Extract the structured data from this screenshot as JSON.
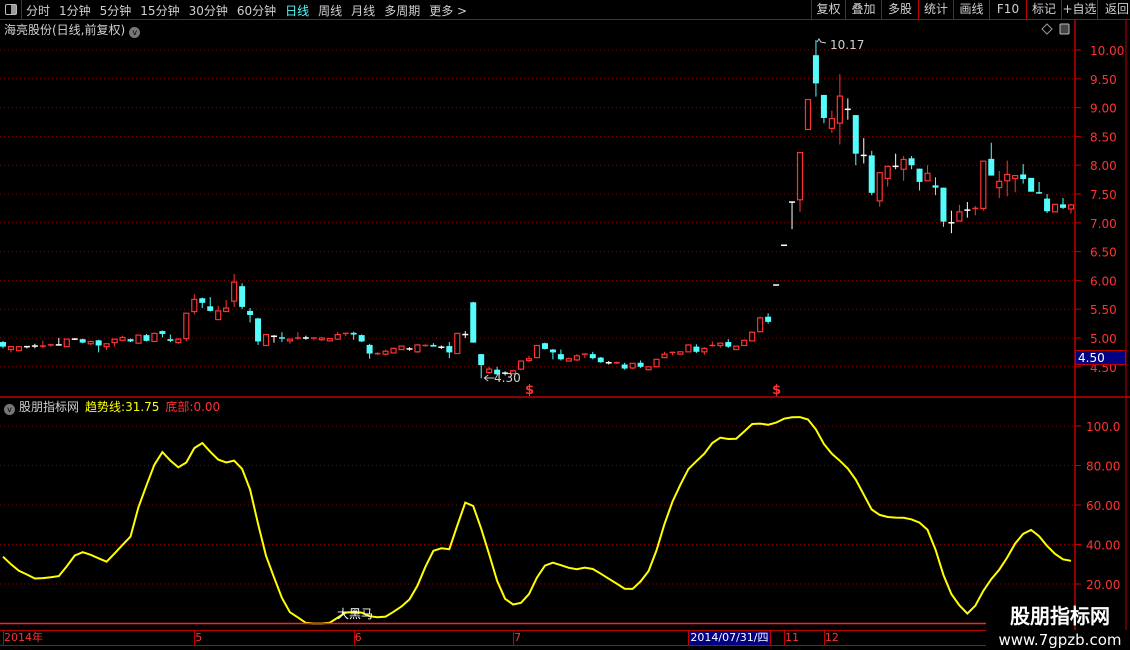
{
  "toolbar": {
    "tabs": [
      "分时",
      "1分钟",
      "5分钟",
      "15分钟",
      "30分钟",
      "60分钟",
      "日线",
      "周线",
      "月线",
      "多周期",
      "更多 >"
    ],
    "active_tab": "日线",
    "right_buttons": [
      "复权",
      "叠加",
      "多股",
      "统计",
      "画线",
      "F10",
      "标记",
      "+自选",
      "返回"
    ]
  },
  "price_panel": {
    "title": "海亮股份(日线,前复权)",
    "high_label": "10.17",
    "low_label": "4.30",
    "cursor_price": "4.50",
    "signal_marker": "$",
    "axis_ticks": [
      "10.00",
      "9.50",
      "9.00",
      "8.50",
      "8.00",
      "7.50",
      "7.00",
      "6.50",
      "6.00",
      "5.50",
      "5.00",
      "4.50"
    ]
  },
  "indicator_panel": {
    "name": "股朋指标网",
    "trend_label": "趋势线:",
    "trend_value": "31.75",
    "bottom_label": "底部:",
    "bottom_value": "0.00",
    "annotation": "大黑马",
    "axis_ticks": [
      "100.0",
      "80.00",
      "60.00",
      "40.00",
      "20.00"
    ]
  },
  "date_axis": {
    "labels": [
      {
        "text": "2014年",
        "index": 0
      },
      {
        "text": "5",
        "index": 24
      },
      {
        "text": "6",
        "index": 44
      },
      {
        "text": "7",
        "index": 64
      },
      {
        "text": "11",
        "index": 98
      },
      {
        "text": "12",
        "index": 103
      }
    ],
    "cursor_date": "2014/07/31/四",
    "cursor_index": 86
  },
  "watermark": {
    "line1": "股朋指标网",
    "line2": "www.7gpzb.com"
  },
  "colors": {
    "up": "#ff3232",
    "down": "#54fcfc",
    "flat": "#ffffff",
    "trend": "#ffff00",
    "axis": "#c00000",
    "accent": "#54fcfc"
  },
  "chart_data": [
    {
      "type": "candlestick",
      "title": "海亮股份(日线,前复权)",
      "ylim": [
        4.3,
        10.3
      ],
      "grid": true,
      "ohlc_columns": [
        "open",
        "high",
        "low",
        "close"
      ],
      "signals_at_index": [
        66,
        97
      ],
      "candles": [
        [
          4.93,
          4.95,
          4.82,
          4.85
        ],
        [
          4.8,
          4.86,
          4.75,
          4.85
        ],
        [
          4.78,
          4.86,
          4.77,
          4.85
        ],
        [
          4.85,
          4.86,
          4.82,
          4.85
        ],
        [
          4.86,
          4.9,
          4.82,
          4.86
        ],
        [
          4.84,
          4.95,
          4.82,
          4.86
        ],
        [
          4.86,
          4.9,
          4.85,
          4.88
        ],
        [
          4.88,
          5.0,
          4.87,
          4.88
        ],
        [
          4.85,
          4.99,
          4.84,
          4.98
        ],
        [
          4.98,
          5.0,
          4.97,
          4.98
        ],
        [
          4.98,
          4.99,
          4.91,
          4.92
        ],
        [
          4.9,
          4.95,
          4.88,
          4.94
        ],
        [
          4.96,
          4.97,
          4.75,
          4.87
        ],
        [
          4.85,
          4.91,
          4.79,
          4.9
        ],
        [
          4.92,
          4.99,
          4.85,
          4.98
        ],
        [
          4.96,
          5.04,
          4.95,
          5.01
        ],
        [
          4.98,
          4.99,
          4.93,
          4.94
        ],
        [
          4.91,
          5.06,
          4.9,
          5.05
        ],
        [
          5.05,
          5.07,
          4.94,
          4.95
        ],
        [
          4.94,
          5.09,
          4.93,
          5.08
        ],
        [
          5.12,
          5.13,
          5.01,
          5.07
        ],
        [
          4.98,
          5.06,
          4.93,
          4.95
        ],
        [
          4.92,
          5.0,
          4.9,
          4.98
        ],
        [
          4.99,
          5.44,
          4.94,
          5.43
        ],
        [
          5.46,
          5.76,
          5.41,
          5.67
        ],
        [
          5.69,
          5.7,
          5.52,
          5.61
        ],
        [
          5.55,
          5.71,
          5.46,
          5.47
        ],
        [
          5.32,
          5.56,
          5.31,
          5.47
        ],
        [
          5.46,
          5.66,
          5.45,
          5.52
        ],
        [
          5.64,
          6.11,
          5.54,
          5.97
        ],
        [
          5.9,
          5.95,
          5.5,
          5.54
        ],
        [
          5.47,
          5.52,
          5.27,
          5.4
        ],
        [
          5.34,
          5.35,
          4.88,
          4.94
        ],
        [
          4.87,
          5.07,
          4.86,
          5.06
        ],
        [
          5.03,
          5.05,
          4.92,
          5.03
        ],
        [
          5.0,
          5.1,
          4.93,
          4.98
        ],
        [
          4.95,
          4.99,
          4.9,
          4.98
        ],
        [
          4.98,
          5.1,
          4.97,
          5.0
        ],
        [
          5.0,
          5.04,
          4.97,
          5.0
        ],
        [
          4.98,
          5.01,
          4.96,
          5.0
        ],
        [
          4.97,
          5.02,
          4.95,
          5.0
        ],
        [
          4.95,
          5.0,
          4.94,
          4.99
        ],
        [
          4.98,
          5.11,
          4.97,
          5.06
        ],
        [
          5.06,
          5.08,
          5.03,
          5.08
        ],
        [
          5.09,
          5.11,
          4.97,
          5.06
        ],
        [
          5.05,
          5.06,
          4.93,
          4.94
        ],
        [
          4.88,
          4.9,
          4.64,
          4.73
        ],
        [
          4.71,
          4.75,
          4.7,
          4.73
        ],
        [
          4.72,
          4.8,
          4.7,
          4.77
        ],
        [
          4.74,
          4.83,
          4.73,
          4.82
        ],
        [
          4.8,
          4.86,
          4.79,
          4.86
        ],
        [
          4.81,
          4.84,
          4.78,
          4.81
        ],
        [
          4.76,
          4.9,
          4.74,
          4.88
        ],
        [
          4.86,
          4.89,
          4.85,
          4.87
        ],
        [
          4.88,
          4.91,
          4.85,
          4.85
        ],
        [
          4.84,
          4.87,
          4.81,
          4.84
        ],
        [
          4.86,
          4.93,
          4.65,
          4.75
        ],
        [
          4.73,
          5.09,
          4.72,
          5.08
        ],
        [
          5.06,
          5.12,
          5.0,
          5.06
        ],
        [
          5.62,
          5.63,
          4.92,
          4.92
        ],
        [
          4.72,
          4.72,
          4.3,
          4.53
        ],
        [
          4.4,
          4.5,
          4.38,
          4.46
        ],
        [
          4.45,
          4.5,
          4.36,
          4.37
        ],
        [
          4.39,
          4.42,
          4.35,
          4.39
        ],
        [
          4.38,
          4.45,
          4.37,
          4.43
        ],
        [
          4.46,
          4.61,
          4.44,
          4.6
        ],
        [
          4.61,
          4.69,
          4.58,
          4.64
        ],
        [
          4.66,
          4.88,
          4.65,
          4.87
        ],
        [
          4.91,
          4.92,
          4.8,
          4.81
        ],
        [
          4.8,
          4.81,
          4.63,
          4.75
        ],
        [
          4.72,
          4.8,
          4.61,
          4.63
        ],
        [
          4.6,
          4.66,
          4.59,
          4.64
        ],
        [
          4.62,
          4.72,
          4.6,
          4.69
        ],
        [
          4.71,
          4.72,
          4.65,
          4.72
        ],
        [
          4.72,
          4.76,
          4.63,
          4.65
        ],
        [
          4.66,
          4.67,
          4.57,
          4.58
        ],
        [
          4.57,
          4.6,
          4.54,
          4.57
        ],
        [
          4.56,
          4.59,
          4.55,
          4.57
        ],
        [
          4.54,
          4.57,
          4.45,
          4.47
        ],
        [
          4.48,
          4.57,
          4.46,
          4.56
        ],
        [
          4.57,
          4.61,
          4.48,
          4.5
        ],
        [
          4.45,
          4.51,
          4.44,
          4.5
        ],
        [
          4.5,
          4.64,
          4.49,
          4.63
        ],
        [
          4.66,
          4.76,
          4.65,
          4.72
        ],
        [
          4.74,
          4.76,
          4.7,
          4.75
        ],
        [
          4.72,
          4.77,
          4.71,
          4.76
        ],
        [
          4.76,
          4.89,
          4.75,
          4.88
        ],
        [
          4.85,
          4.89,
          4.74,
          4.76
        ],
        [
          4.76,
          4.84,
          4.71,
          4.82
        ],
        [
          4.86,
          4.94,
          4.85,
          4.87
        ],
        [
          4.87,
          4.91,
          4.83,
          4.91
        ],
        [
          4.93,
          4.98,
          4.83,
          4.85
        ],
        [
          4.8,
          4.87,
          4.79,
          4.86
        ],
        [
          4.87,
          4.97,
          4.86,
          4.96
        ],
        [
          4.95,
          5.11,
          4.94,
          5.1
        ],
        [
          5.11,
          5.37,
          5.1,
          5.35
        ],
        [
          5.37,
          5.43,
          5.25,
          5.28
        ],
        [
          5.92,
          5.92,
          5.92,
          5.92
        ],
        [
          6.61,
          6.61,
          6.61,
          6.61
        ],
        [
          7.36,
          7.36,
          6.89,
          7.36
        ],
        [
          7.4,
          8.22,
          7.19,
          8.22
        ],
        [
          8.62,
          9.14,
          8.62,
          9.14
        ],
        [
          9.91,
          10.17,
          9.19,
          9.42
        ],
        [
          9.22,
          9.22,
          8.73,
          8.82
        ],
        [
          8.64,
          8.95,
          8.56,
          8.81
        ],
        [
          8.73,
          9.58,
          8.36,
          9.2
        ],
        [
          8.97,
          9.16,
          8.79,
          8.97
        ],
        [
          8.87,
          8.87,
          8.0,
          8.2
        ],
        [
          8.17,
          8.47,
          8.03,
          8.17
        ],
        [
          8.17,
          8.25,
          7.48,
          7.52
        ],
        [
          7.38,
          7.88,
          7.28,
          7.87
        ],
        [
          7.77,
          7.98,
          7.63,
          7.98
        ],
        [
          7.98,
          8.2,
          7.93,
          7.98
        ],
        [
          7.93,
          8.16,
          7.73,
          8.1
        ],
        [
          8.12,
          8.16,
          7.93,
          8.0
        ],
        [
          7.94,
          7.94,
          7.56,
          7.71
        ],
        [
          7.73,
          8.0,
          7.73,
          7.86
        ],
        [
          7.65,
          7.79,
          7.48,
          7.61
        ],
        [
          7.61,
          7.61,
          6.93,
          7.02
        ],
        [
          7.0,
          7.21,
          6.82,
          7.0
        ],
        [
          7.03,
          7.31,
          7.03,
          7.19
        ],
        [
          7.22,
          7.36,
          7.09,
          7.22
        ],
        [
          7.24,
          7.29,
          7.13,
          7.25
        ],
        [
          7.25,
          8.07,
          7.21,
          8.07
        ],
        [
          8.11,
          8.39,
          7.82,
          7.82
        ],
        [
          7.61,
          7.9,
          7.43,
          7.72
        ],
        [
          7.73,
          8.08,
          7.46,
          7.84
        ],
        [
          7.77,
          7.82,
          7.53,
          7.82
        ],
        [
          7.84,
          8.02,
          7.68,
          7.76
        ],
        [
          7.78,
          7.78,
          7.54,
          7.54
        ],
        [
          7.52,
          7.71,
          7.5,
          7.51
        ],
        [
          7.42,
          7.5,
          7.17,
          7.2
        ],
        [
          7.19,
          7.32,
          7.19,
          7.32
        ],
        [
          7.32,
          7.43,
          7.24,
          7.26
        ],
        [
          7.24,
          7.33,
          7.16,
          7.31
        ]
      ]
    },
    {
      "type": "line",
      "ylim": [
        0,
        108
      ],
      "grid": true,
      "series": [
        {
          "name": "趋势线",
          "values": [
            33.8,
            30,
            26.7,
            24.8,
            22.8,
            23,
            23.4,
            24,
            29,
            34.4,
            36.1,
            34.8,
            33,
            31.3,
            35.5,
            39.8,
            44,
            59,
            70,
            80.4,
            86.8,
            82.5,
            79.1,
            81.5,
            88.8,
            91.4,
            87,
            83,
            81.5,
            82.5,
            78.3,
            67.8,
            50.6,
            34.3,
            23.4,
            13,
            5.7,
            3.1,
            0.3,
            0,
            0,
            0.4,
            3,
            5.5,
            5.8,
            5.5,
            3.7,
            3.2,
            3.5,
            5.9,
            8.6,
            12.2,
            19.1,
            28.7,
            36.8,
            38.1,
            37.6,
            49.6,
            61.2,
            59.5,
            48,
            35,
            21.6,
            12.5,
            9.6,
            10.5,
            14.9,
            23.3,
            29.3,
            30.8,
            29.5,
            28.2,
            27.5,
            28.3,
            27.6,
            25.2,
            22.7,
            20.2,
            17.6,
            17.5,
            21.3,
            26.6,
            37,
            50.4,
            61.7,
            70.3,
            78.2,
            82.2,
            86,
            91.4,
            94.1,
            93.4,
            93.5,
            97.2,
            101,
            101.2,
            100.6,
            101.7,
            103.7,
            104.4,
            104.5,
            103.3,
            98.3,
            90.9,
            85.9,
            82.4,
            78.5,
            72.8,
            65.2,
            57.7,
            55,
            53.9,
            53.6,
            53.5,
            52.7,
            51.1,
            47.5,
            37.4,
            24.5,
            14.9,
            9.2,
            5,
            9,
            16.5,
            22.5,
            27.3,
            33.4,
            40.5,
            45.4,
            47.4,
            44.2,
            39.3,
            35.3,
            32.5,
            31.75
          ]
        },
        {
          "name": "底部",
          "values": [
            0
          ]
        }
      ]
    }
  ]
}
